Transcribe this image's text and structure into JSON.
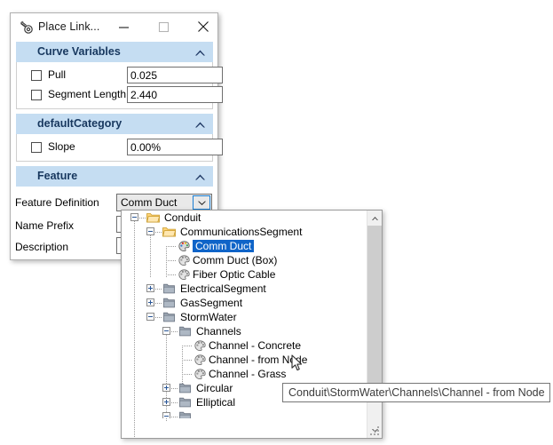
{
  "window": {
    "title": "Place Link...",
    "icon": "place-link-tool-icon",
    "buttons": {
      "minimize": "minimize-icon",
      "maximize": "maximize-icon",
      "close": "close-icon"
    }
  },
  "groups": [
    {
      "title": "Curve Variables",
      "collapse_icon": "chevron-up-icon",
      "fields": [
        {
          "label": "Pull",
          "checked": false,
          "value": "0.025"
        },
        {
          "label": "Segment Length",
          "checked": false,
          "value": "2.440"
        }
      ]
    },
    {
      "title": "defaultCategory",
      "collapse_icon": "chevron-up-icon",
      "fields": [
        {
          "label": "Slope",
          "checked": false,
          "value": "0.00%"
        }
      ]
    },
    {
      "title": "Feature",
      "collapse_icon": "chevron-up-icon",
      "fields": [
        {
          "label": "Feature Definition",
          "value": "Comm Duct"
        },
        {
          "label": "Name Prefix",
          "value": ""
        },
        {
          "label": "Description",
          "value": ""
        }
      ]
    }
  ],
  "combo": {
    "value": "Comm Duct",
    "arrow_icon": "chevron-down-icon"
  },
  "tree": {
    "items": [
      {
        "label": "Conduit",
        "depth": 0,
        "type": "folder-open",
        "expander": "minus",
        "selected": false
      },
      {
        "label": "CommunicationsSegment",
        "depth": 1,
        "type": "folder-open",
        "expander": "minus",
        "selected": false
      },
      {
        "label": "Comm Duct",
        "depth": 2,
        "type": "feature-color",
        "expander": "none",
        "selected": true
      },
      {
        "label": "Comm Duct (Box)",
        "depth": 2,
        "type": "feature-gray",
        "expander": "none",
        "selected": false
      },
      {
        "label": "Fiber Optic Cable",
        "depth": 2,
        "type": "feature-gray",
        "expander": "none",
        "selected": false
      },
      {
        "label": "ElectricalSegment",
        "depth": 1,
        "type": "folder-closed",
        "expander": "plus",
        "selected": false
      },
      {
        "label": "GasSegment",
        "depth": 1,
        "type": "folder-closed",
        "expander": "plus",
        "selected": false
      },
      {
        "label": "StormWater",
        "depth": 1,
        "type": "folder-closed",
        "expander": "minus",
        "selected": false
      },
      {
        "label": "Channels",
        "depth": 2,
        "type": "folder-closed",
        "expander": "minus",
        "selected": false
      },
      {
        "label": "Channel - Concrete",
        "depth": 3,
        "type": "feature-gray",
        "expander": "none",
        "selected": false
      },
      {
        "label": "Channel - from Node",
        "depth": 3,
        "type": "feature-gray",
        "expander": "none",
        "selected": false
      },
      {
        "label": "Channel - Grass",
        "depth": 3,
        "type": "feature-gray",
        "expander": "none",
        "selected": false
      },
      {
        "label": "Circular",
        "depth": 2,
        "type": "folder-closed",
        "expander": "plus",
        "selected": false
      },
      {
        "label": "Elliptical",
        "depth": 2,
        "type": "folder-closed",
        "expander": "plus",
        "selected": false
      },
      {
        "label": "",
        "depth": 2,
        "type": "folder-closed",
        "expander": "minus",
        "selected": false
      }
    ],
    "scrollbar": {
      "up_icon": "scroll-up-icon",
      "down_icon": "scroll-down-icon"
    },
    "resize_grip": "resize-grip-icon"
  },
  "tooltip": {
    "text": "Conduit\\StormWater\\Channels\\Channel - from Node"
  },
  "cursor": {
    "icon": "mouse-pointer-icon"
  },
  "colors": {
    "group_header_bg": "#c5ddf2",
    "group_header_text": "#17375e",
    "selection_bg": "#0f64c8",
    "selection_text": "#ffffff",
    "folder_open": "#ffc societal"
  }
}
